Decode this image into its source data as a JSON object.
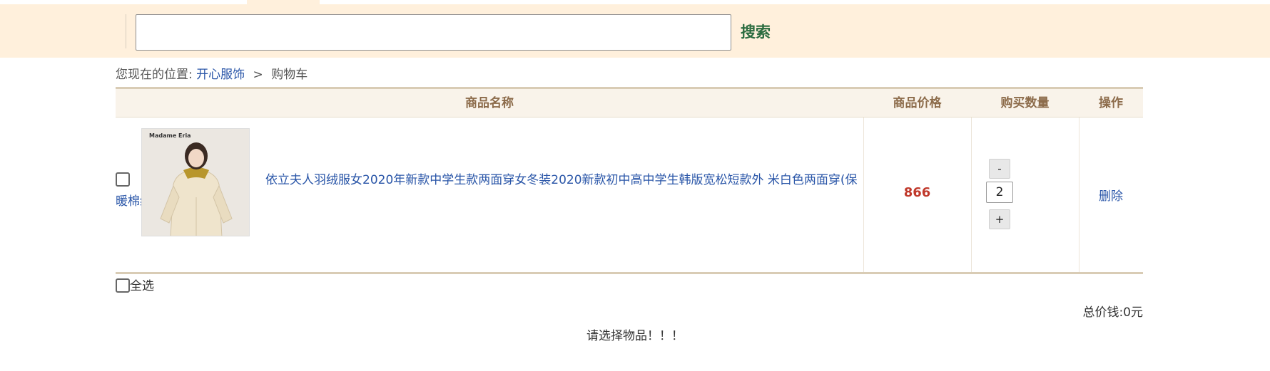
{
  "search": {
    "value": "",
    "placeholder": "",
    "button_label": "搜索"
  },
  "breadcrumb": {
    "prefix": "您现在的位置:",
    "shop": "开心服饰",
    "separator": ">",
    "current": "购物车"
  },
  "table": {
    "headers": {
      "name": "商品名称",
      "price": "商品价格",
      "quantity": "购买数量",
      "operation": "操作"
    },
    "rows": [
      {
        "title": "依立夫人羽绒服女2020年新款中学生款两面穿女冬装2020新款初中高中学生韩版宽松短款外 米白色两面穿(保暖棉绒) S",
        "image_brand": "Madame Eria",
        "price": "866",
        "quantity": "2",
        "minus_label": "-",
        "plus_label": "+",
        "delete_label": "删除"
      }
    ]
  },
  "select_all_label": "全选",
  "total": "总价钱:0元",
  "notice": "请选择物品！！！",
  "colors": {
    "topbar": "#fff0dc",
    "link": "#2a56a8",
    "price": "#c0392b",
    "header_text": "#8c6b4a",
    "search_button": "#2a6b3e"
  }
}
